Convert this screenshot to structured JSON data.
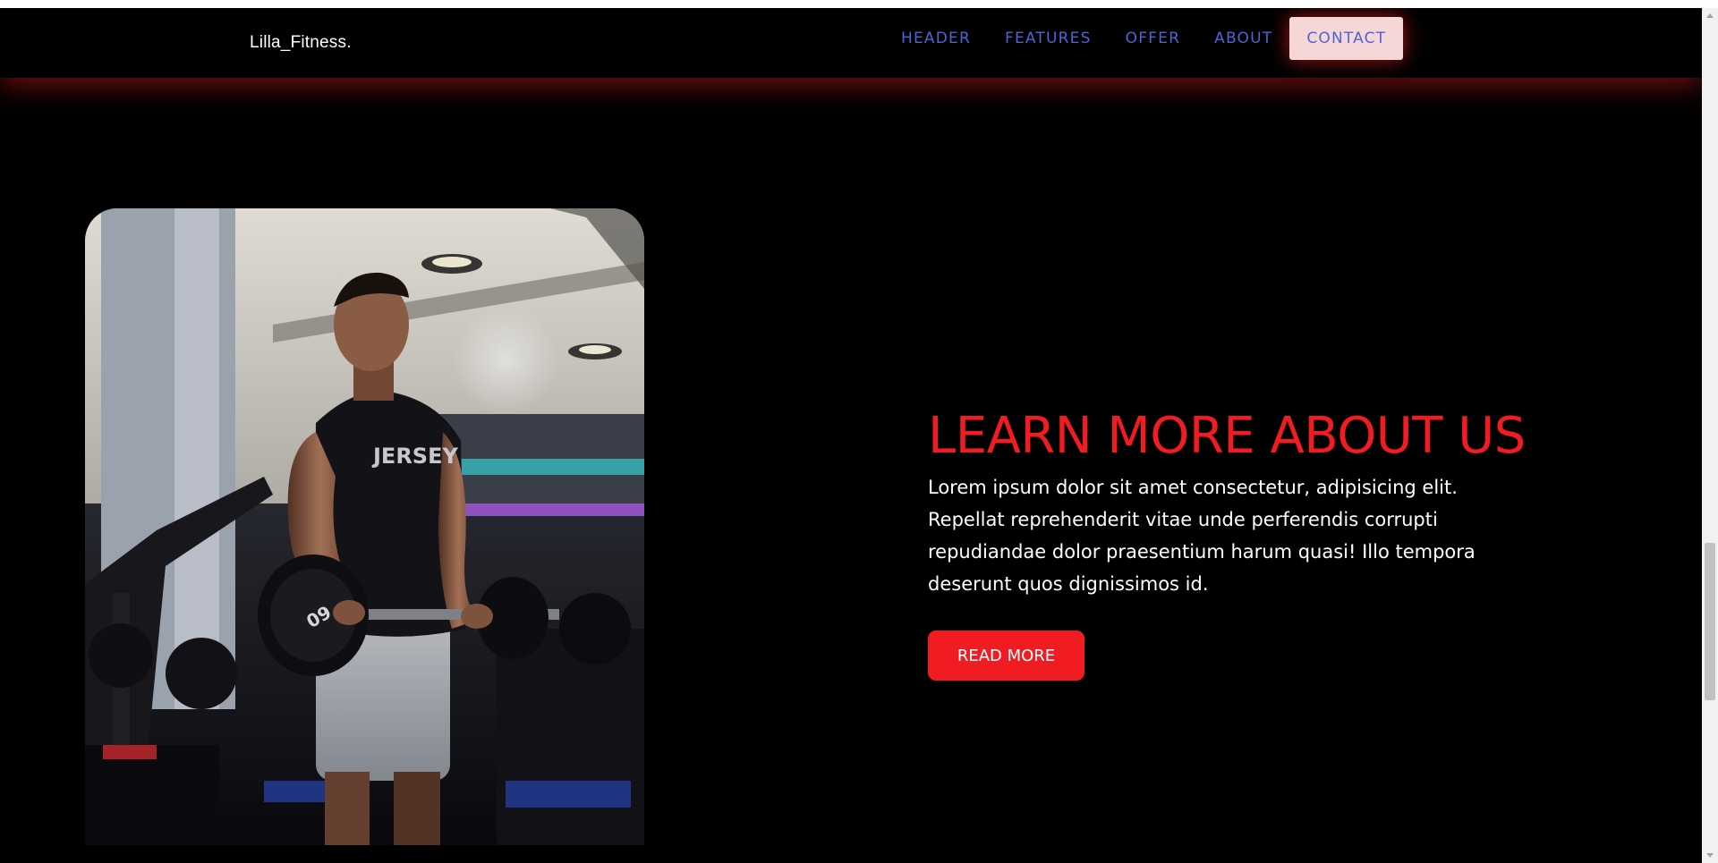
{
  "navbar": {
    "brand": "Lilla_Fitness.",
    "items": [
      {
        "label": "HEADER",
        "active": false
      },
      {
        "label": "FEATURES",
        "active": false
      },
      {
        "label": "OFFER",
        "active": false
      },
      {
        "label": "ABOUT",
        "active": false
      },
      {
        "label": "CONTACT",
        "active": true
      }
    ]
  },
  "about": {
    "heading": "LEARN MORE ABOUT US",
    "body": "Lorem ipsum dolor sit amet consectetur, adipisicing elit. Repellat reprehenderit vitae unde perferendis corrupti repudiandae dolor praesentium harum quasi! Illo tempora deserunt quos dignissimos id.",
    "button_label": "READ MORE",
    "image": {
      "subject": "man lifting barbell in gym",
      "shirt_text": "JERSEY",
      "plate_text": "60"
    }
  },
  "colors": {
    "accent": "#f01c22",
    "nav_link": "#4f63d6",
    "background": "#000000",
    "active_nav_bg": "#f6d7d8"
  }
}
